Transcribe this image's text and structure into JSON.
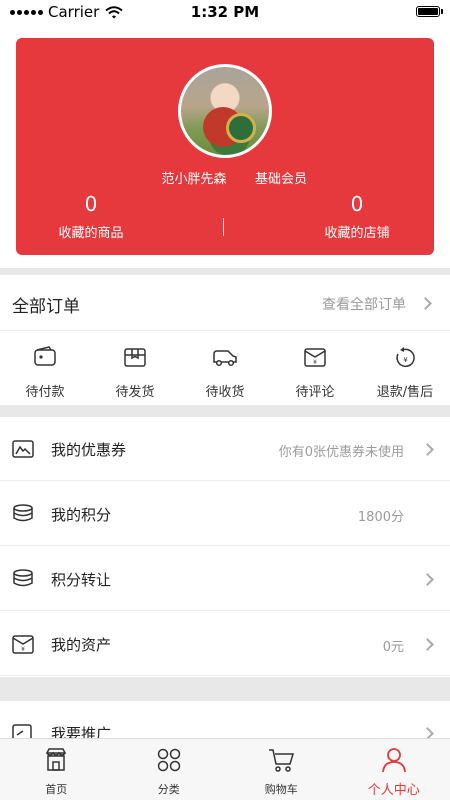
{
  "status_bar": {
    "carrier": "Carrier",
    "time": "1:32 PM"
  },
  "profile": {
    "username": "范小胖先森",
    "member_level": "基础会员",
    "favorites_goods": {
      "count": "0",
      "label": "收藏的商品"
    },
    "favorites_shops": {
      "count": "0",
      "label": "收藏的店铺"
    }
  },
  "orders": {
    "title": "全部订单",
    "view_all": "查看全部订单",
    "items": [
      {
        "label": "待付款",
        "icon": "wallet-icon"
      },
      {
        "label": "待发货",
        "icon": "package-icon"
      },
      {
        "label": "待收货",
        "icon": "truck-icon"
      },
      {
        "label": "待评论",
        "icon": "review-envelope-icon"
      },
      {
        "label": "退款/售后",
        "icon": "refund-icon"
      }
    ]
  },
  "menu": [
    {
      "label": "我的优惠券",
      "value": "你有0张优惠券未使用",
      "icon": "coupon-icon",
      "arrow": true
    },
    {
      "label": "我的积分",
      "value": "1800分",
      "icon": "coins-icon",
      "arrow": false
    },
    {
      "label": "积分转让",
      "value": "",
      "icon": "coins-icon",
      "arrow": true
    },
    {
      "label": "我的资产",
      "value": "0元",
      "icon": "assets-icon",
      "arrow": true
    },
    {
      "label": "我要推广",
      "value": "",
      "icon": "promote-icon",
      "arrow": true
    }
  ],
  "tabbar": [
    {
      "label": "首页",
      "icon": "home-store-icon",
      "active": false
    },
    {
      "label": "分类",
      "icon": "category-grid-icon",
      "active": false
    },
    {
      "label": "购物车",
      "icon": "cart-icon",
      "active": false
    },
    {
      "label": "个人中心",
      "icon": "user-icon",
      "active": true
    }
  ],
  "colors": {
    "accent": "#e5393e",
    "divider": "#e8e8e8",
    "muted_text": "#999999"
  }
}
